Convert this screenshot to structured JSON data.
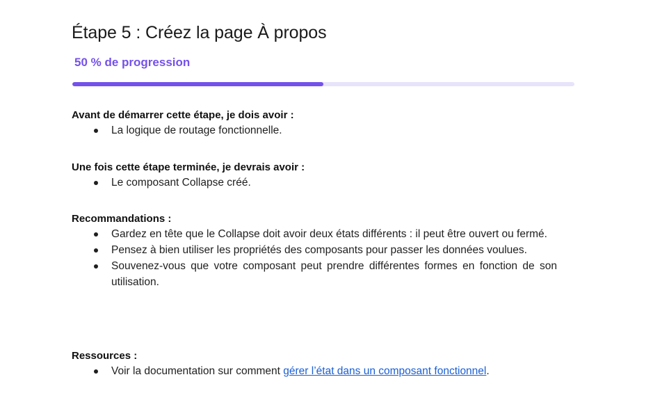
{
  "title": "Étape 5 : Créez la page À propos",
  "progress": {
    "label": "50 % de progression",
    "fraction": 0.5,
    "fill_color": "#7451eb",
    "track_color": "#e7e3fb"
  },
  "sections": {
    "prerequisites": {
      "heading": "Avant de démarrer cette étape, je dois avoir :",
      "items": [
        "La logique de routage fonctionnelle."
      ]
    },
    "outcomes": {
      "heading": "Une fois cette étape terminée, je devrais avoir :",
      "items": [
        "Le composant Collapse créé."
      ]
    },
    "recommendations": {
      "heading": "Recommandations :",
      "items": [
        "Gardez en tête que le Collapse doit avoir deux états différents : il peut être ouvert ou fermé.",
        "Pensez à bien utiliser les propriétés des composants pour passer les données voulues.",
        "Souvenez-vous que votre composant peut prendre différentes formes en fonction de son utilisation."
      ]
    },
    "resources": {
      "heading": "Ressources :",
      "item_prefix": "Voir la documentation sur comment ",
      "link_text": "gérer l’état dans un composant fonctionnel",
      "item_suffix": "."
    }
  },
  "link_color": "#1a5fd6"
}
